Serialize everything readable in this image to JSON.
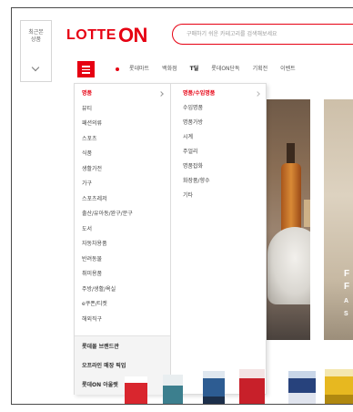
{
  "recent_viewed": {
    "line1": "최근본",
    "line2": "상품"
  },
  "logo": {
    "lotte": "LOTTE",
    "on": "ON"
  },
  "search": {
    "placeholder": "구매하기 쉬운 카테고리를 검색해보세요"
  },
  "nav": {
    "items": [
      "롯데마트",
      "백화점",
      "T딜",
      "롯데ON단독",
      "기획전",
      "이벤트"
    ]
  },
  "menu": {
    "categories": [
      "명품",
      "뷰티",
      "패션의류",
      "스포츠",
      "식품",
      "생활가전",
      "가구",
      "스포츠레저",
      "출산/유아동/완구/문구",
      "도서",
      "자동차용품",
      "반려동물",
      "취미용품",
      "주방/생활/욕실",
      "e쿠폰/티켓",
      "해외직구"
    ],
    "services": [
      "롯데몰 브랜드관",
      "오프라인 매장 픽업",
      "롯데ON 아울렛"
    ],
    "subcategory_title": "명품/수입명품",
    "subcategories": [
      "수입명품",
      "명품가방",
      "시계",
      "주얼리",
      "명품잡화",
      "화장품/향수",
      "기타"
    ]
  },
  "banner": {
    "text_lines": [
      "F",
      "F",
      "A",
      "S"
    ]
  },
  "colors": {
    "brand": "#e60012",
    "menu_border": "#dcdcdc",
    "services_bg": "#f4f4f4"
  }
}
